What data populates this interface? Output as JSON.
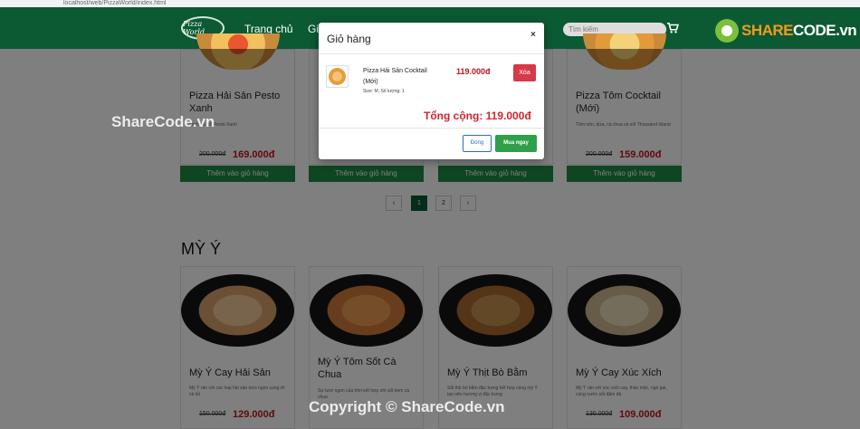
{
  "browser": {
    "url": "localhost/web/PizzaWorld/index.html"
  },
  "navbar": {
    "logo": "Pizza World",
    "links": [
      "Trang chủ",
      "Gi"
    ],
    "search_placeholder": "Tìm kiếm"
  },
  "watermark": {
    "logo_prefix": "SHARE",
    "logo_suffix": "CODE.vn",
    "center": "ShareCode.vn",
    "bottom": "Copyright © ShareCode.vn"
  },
  "top_products": [
    {
      "name": "Pizza Hải Sản Pesto Xanh",
      "desc": "xanh và sốt Pesto Xanh",
      "old_price": "200.000đ",
      "price": "169.000đ",
      "button": "Thêm vào giỏ hàng"
    },
    {
      "name": "",
      "desc": "",
      "old_price": "",
      "price": "",
      "button": "Thêm vào giỏ hàng"
    },
    {
      "name": "",
      "desc": "",
      "old_price": "",
      "price": "",
      "button": "Thêm vào giỏ hàng"
    },
    {
      "name": "Pizza Tôm Cocktail (Mới)",
      "desc": "Tôm nõn, dứa, cà chua và sốt Thousand Island",
      "old_price": "200.000đ",
      "price": "159.000đ",
      "button": "Thêm vào giỏ hàng"
    }
  ],
  "pagination": {
    "prev": "‹",
    "pages": [
      "1",
      "2"
    ],
    "next": "›"
  },
  "section": {
    "title": "MỲ Ý"
  },
  "pasta_products": [
    {
      "name": "Mỳ Ý Cay Hải Sản",
      "desc": "Mỳ Ý rán với các loại hải sản tươi ngon cùng ớt và tỏi",
      "old_price": "150.000đ",
      "price": "129.000đ"
    },
    {
      "name": "Mỳ Ý Tôm Sốt Cà Chua",
      "desc": "Sự tươi ngon của tôm kết hợp với sốt kem cà chua",
      "old_price": "",
      "price": ""
    },
    {
      "name": "Mỳ Ý Thịt Bò Bằm",
      "desc": "Sốt thịt bò bằm đặc trưng kết hợp cùng mỳ Ý tạo nên hương vị đặc trưng",
      "old_price": "",
      "price": ""
    },
    {
      "name": "Mỳ Ý Cay Xúc Xích",
      "desc": "Mỳ Ý rán với xúc xích cay, thảo mộc, ngò gai, cùng nước sốt đậm đà",
      "old_price": "130.000đ",
      "price": "109.000đ"
    }
  ],
  "cart_modal": {
    "title": "Giỏ hàng",
    "close_symbol": "×",
    "item": {
      "name": "Pizza Hải Sản Cocktail (Mới)",
      "size": "Size: M, Số lượng: 1",
      "price": "119.000đ",
      "remove": "Xóa"
    },
    "total_label": "Tổng cộng:",
    "total_value": "119.000đ",
    "close_button": "Đóng",
    "buy_button": "Mua ngay"
  }
}
